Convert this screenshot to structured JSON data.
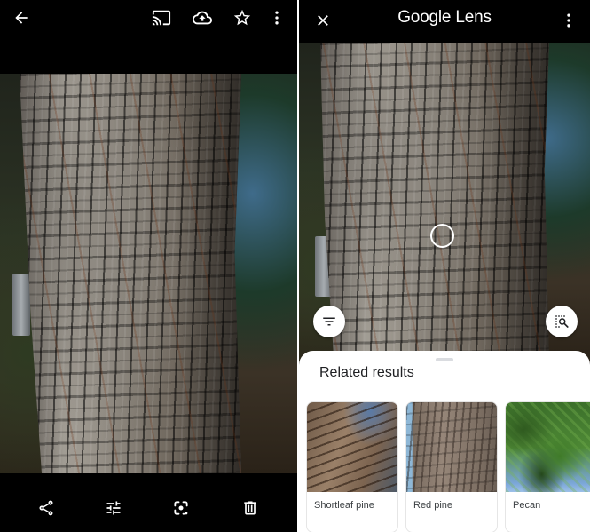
{
  "left_screen": {
    "name": "Photo viewer",
    "top_bar": {
      "back": {
        "icon": "arrow-left-icon",
        "label": "Back"
      },
      "actions": [
        {
          "icon": "cast-icon",
          "label": "Cast"
        },
        {
          "icon": "cloud-upload-icon",
          "label": "Back up"
        },
        {
          "icon": "star-outline-icon",
          "label": "Favorite"
        },
        {
          "icon": "more-vert-icon",
          "label": "More options"
        }
      ]
    },
    "photo": {
      "subject": "tree trunk with bark"
    },
    "bottom_bar": {
      "actions": [
        {
          "icon": "share-icon",
          "label": "Share"
        },
        {
          "icon": "tune-icon",
          "label": "Edit"
        },
        {
          "icon": "google-lens-icon",
          "label": "Lens"
        },
        {
          "icon": "trash-icon",
          "label": "Delete"
        }
      ]
    }
  },
  "right_screen": {
    "name": "Google Lens",
    "top_bar": {
      "close": {
        "icon": "close-icon",
        "label": "Close"
      },
      "title": "Google Lens",
      "more": {
        "icon": "more-vert-icon",
        "label": "More options"
      }
    },
    "photo": {
      "subject": "tree trunk with bark"
    },
    "filter_button": {
      "icon": "filter-icon",
      "label": "Filters"
    },
    "image_search_button": {
      "icon": "image-search-icon",
      "label": "Search region"
    },
    "results_sheet": {
      "title": "Related results",
      "results": [
        {
          "label": "Shortleaf pine",
          "image": "pine bark looking up"
        },
        {
          "label": "Red pine",
          "image": "red pine bark"
        },
        {
          "label": "Pecan",
          "image": "pecan leaves"
        }
      ]
    }
  },
  "colors": {
    "bar_background": "#000000",
    "icon_color": "#ffffff",
    "sheet_background": "#ffffff",
    "sheet_title": "#202124",
    "card_label": "#3c4043",
    "handle": "#dadce0"
  }
}
